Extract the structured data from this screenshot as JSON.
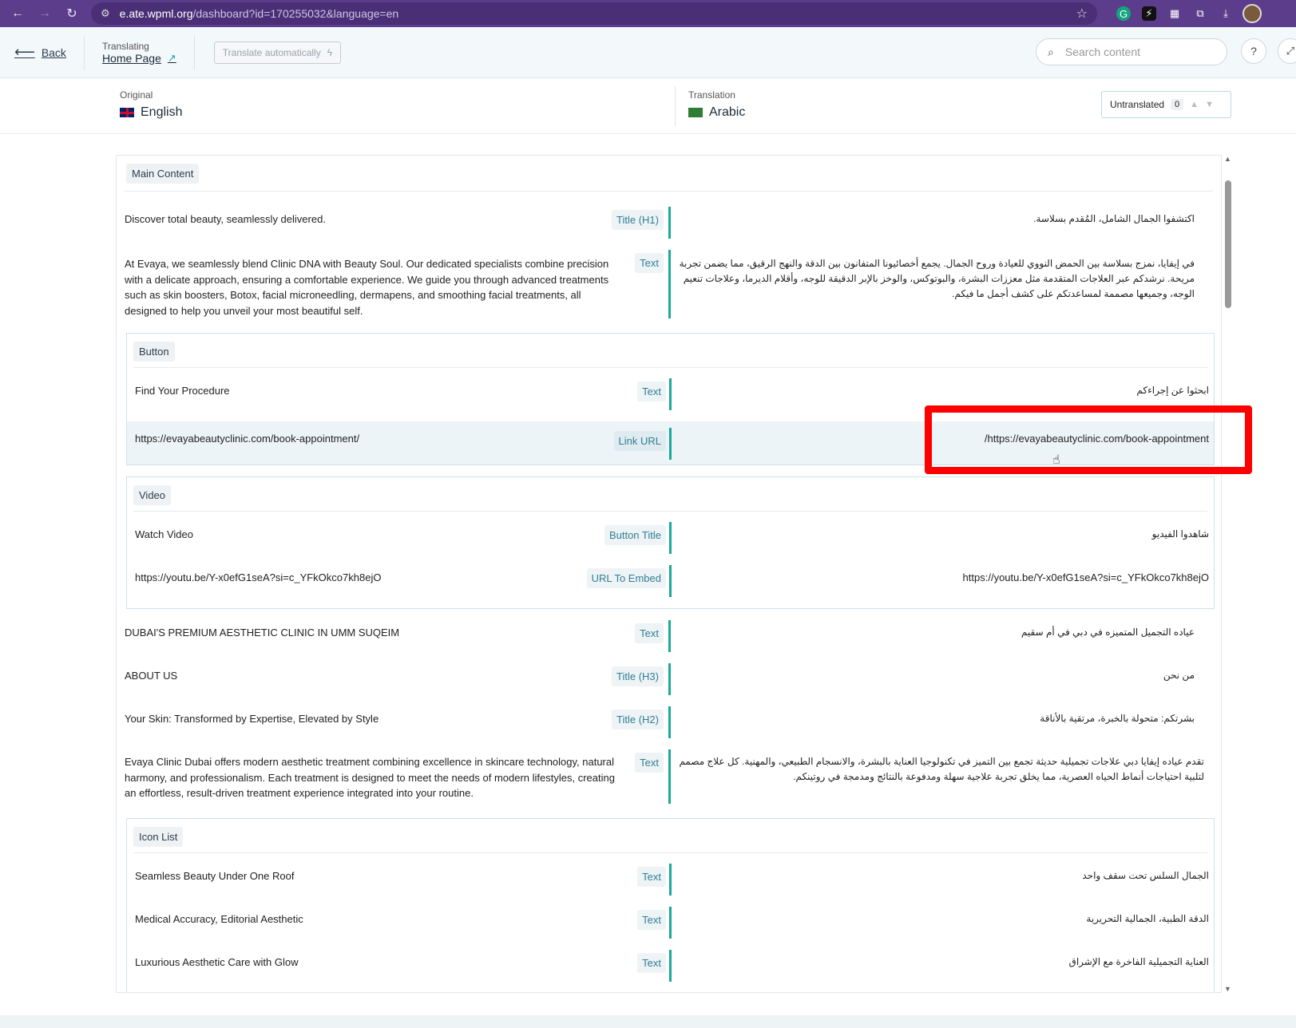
{
  "browser": {
    "url_main": "e.ate.wpml.org",
    "url_rest": "/dashboard?id=170255032&language=en"
  },
  "header": {
    "back_label": "Back",
    "translating_label": "Translating",
    "page_name": "Home Page",
    "auto_translate_label": "Translate automatically",
    "search_placeholder": "Search content"
  },
  "languages": {
    "original_label": "Original",
    "original_value": "English",
    "translation_label": "Translation",
    "translation_value": "Arabic",
    "untranslated_label": "Untranslated",
    "untranslated_count": "0"
  },
  "content": {
    "main_section": "Main Content",
    "rows": [
      {
        "src": "Discover total beauty, seamlessly delivered.",
        "badge": "Title (H1)",
        "tgt": "اكتشفوا الجمال الشامل، المُقدم بسلاسة."
      },
      {
        "src": "At Evaya, we seamlessly blend Clinic DNA with Beauty Soul. Our dedicated specialists combine precision with a delicate approach, ensuring a comfortable experience. We guide you through advanced treatments such as skin boosters, Botox, facial microneedling, dermapens, and smoothing facial treatments, all designed to help you unveil your most beautiful self.",
        "badge": "Text",
        "tgt": "في إيفايا، نمزج بسلاسة بين الحمض النووي للعيادة وروح الجمال. يجمع أخصائيونا المتفانون بين الدقة والنهج الرقيق، مما يضمن تجربة مريحة. نرشدكم عبر العلاجات المتقدمة مثل معززات البشرة، والبوتوكس، والوخز بالإبر الدقيقة للوجه، وأقلام الديرما، وعلاجات تنعيم الوجه، وجميعها مصممة لمساعدتكم على كشف أجمل ما فيكم."
      }
    ],
    "button_group": {
      "title": "Button",
      "rows": [
        {
          "src": "Find Your Procedure",
          "badge": "Text",
          "tgt": "ابحثوا عن إجراءكم"
        },
        {
          "src": "https://evayabeautyclinic.com/book-appointment/",
          "badge": "Link URL",
          "tgt": "/https://evayabeautyclinic.com/book-appointment"
        }
      ]
    },
    "video_group": {
      "title": "Video",
      "rows": [
        {
          "src": "Watch Video",
          "badge": "Button Title",
          "tgt": "شاهدوا الفيديو"
        },
        {
          "src": "https://youtu.be/Y-x0efG1seA?si=c_YFkOkco7kh8ejO",
          "badge": "URL To Embed",
          "tgt": "https://youtu.be/Y-x0efG1seA?si=c_YFkOkco7kh8ejO"
        }
      ]
    },
    "rows2": [
      {
        "src": "DUBAI'S PREMIUM AESTHETIC CLINIC IN UMM SUQEIM",
        "badge": "Text",
        "tgt": "عياده التجميل المتميزه في دبي في أم سقيم"
      },
      {
        "src": "ABOUT US",
        "badge": "Title (H3)",
        "tgt": "من نحن"
      },
      {
        "src": "Your Skin: Transformed by Expertise, Elevated by Style",
        "badge": "Title (H2)",
        "tgt": "بشرتكم: متحولة بالخبرة، مرتقية بالأناقة"
      },
      {
        "src": "Evaya Clinic Dubai offers modern aesthetic treatment combining excellence in skincare technology, natural harmony, and professionalism. Each treatment is designed to meet the needs of modern lifestyles, creating an effortless, result-driven treatment experience integrated into your routine.",
        "badge": "Text",
        "tgt": "تقدم عياده إيفايا دبي علاجات تجميلية حديثة تجمع بين التميز في تكنولوجيا العناية بالبشرة، والانسجام الطبيعي، والمهنية. كل علاج مصمم لتلبية احتياجات أنماط الحياه العصرية، مما يخلق تجربة علاجية سهلة ومدفوعة بالنتائج ومدمجة في روتينكم."
      }
    ],
    "icon_group": {
      "title": "Icon List",
      "rows": [
        {
          "src": "Seamless Beauty Under One Roof",
          "badge": "Text",
          "tgt": "الجمال السلس تحت سقف واحد"
        },
        {
          "src": "Medical Accuracy, Editorial Aesthetic",
          "badge": "Text",
          "tgt": "الدقة الطبية، الجمالية التحريرية"
        },
        {
          "src": "Luxurious Aesthetic Care with Glow",
          "badge": "Text",
          "tgt": "العناية التجميلية الفاخرة مع الإشراق"
        }
      ]
    }
  }
}
